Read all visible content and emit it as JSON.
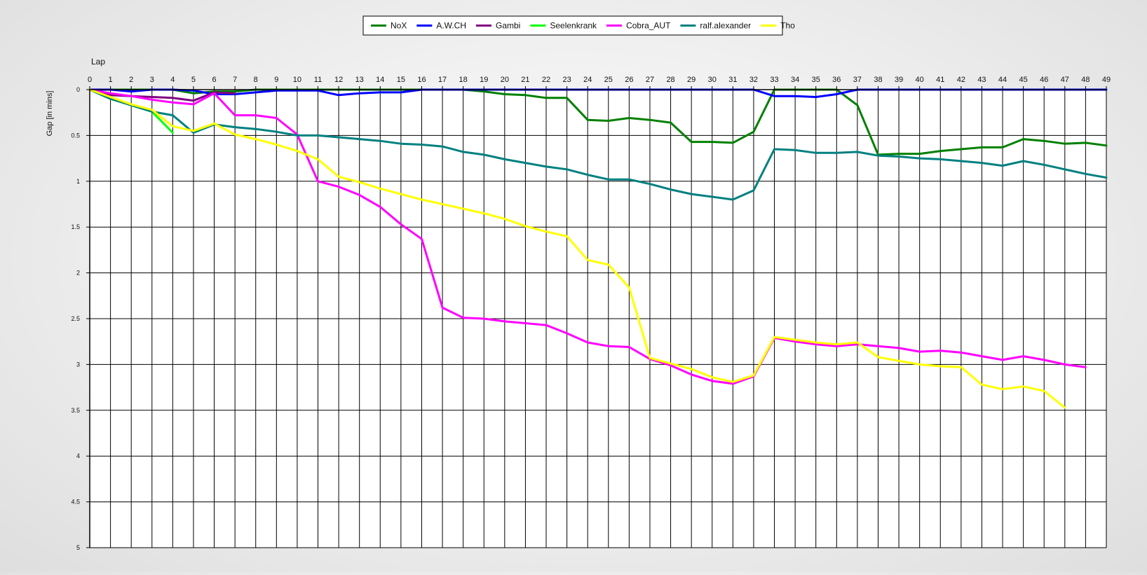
{
  "chart_data": {
    "type": "line",
    "xlabel": "Lap",
    "ylabel": "Gap [in mins]",
    "x": [
      0,
      1,
      2,
      3,
      4,
      5,
      6,
      7,
      8,
      9,
      10,
      11,
      12,
      13,
      14,
      15,
      16,
      17,
      18,
      19,
      20,
      21,
      22,
      23,
      24,
      25,
      26,
      27,
      28,
      29,
      30,
      31,
      32,
      33,
      34,
      35,
      36,
      37,
      38,
      39,
      40,
      41,
      42,
      43,
      44,
      45,
      46,
      47,
      48,
      49
    ],
    "xlim": [
      0,
      49
    ],
    "ylim": [
      0,
      5
    ],
    "y_inverted": true,
    "y_ticks": [
      "0",
      "0.5",
      "1",
      "1.5",
      "2",
      "2.5",
      "3",
      "3.5",
      "4",
      "4.5",
      "5"
    ],
    "grid": true,
    "legend_position": "top-center",
    "series": [
      {
        "name": "NoX",
        "color": "#008000",
        "values": [
          0,
          0,
          0,
          0,
          0,
          0.04,
          0.02,
          0.02,
          0,
          0,
          0,
          0,
          0,
          0,
          0,
          0,
          0,
          0,
          0,
          0.02,
          0.05,
          0.06,
          0.09,
          0.09,
          0.33,
          0.34,
          0.31,
          0.33,
          0.36,
          0.57,
          0.57,
          0.58,
          0.46,
          0,
          0,
          0,
          0,
          0.17,
          0.71,
          0.7,
          0.7,
          0.67,
          0.65,
          0.63,
          0.63,
          0.54,
          0.56,
          0.59,
          0.58,
          0.61
        ]
      },
      {
        "name": "A.W.CH",
        "color": "#0000ff",
        "values": [
          0,
          0,
          0.02,
          0,
          0,
          0.01,
          0.05,
          0.05,
          0.03,
          0.01,
          0.01,
          0.01,
          0.06,
          0.04,
          0.03,
          0.03,
          0,
          0,
          0,
          0,
          0,
          0,
          0,
          0,
          0,
          0,
          0,
          0,
          0,
          0,
          0,
          0,
          0,
          0.07,
          0.07,
          0.08,
          0.05,
          0,
          0,
          0,
          0,
          0,
          0,
          0,
          0,
          0,
          0,
          0,
          0,
          0
        ]
      },
      {
        "name": "Gambi",
        "color": "#800080",
        "values": [
          0,
          0.06,
          0.07,
          0.08,
          0.09,
          0.12,
          0.03,
          0.04,
          null,
          null,
          null,
          null,
          null,
          null,
          null,
          null,
          null,
          null,
          null,
          null,
          null,
          null,
          null,
          null,
          null,
          null,
          null,
          null,
          null,
          null,
          null,
          null,
          null,
          null,
          null,
          null,
          null,
          null,
          null,
          null,
          null,
          null,
          null,
          null,
          null,
          null,
          null,
          null,
          null,
          null
        ]
      },
      {
        "name": "Seelenkrank",
        "color": "#00ff00",
        "values": [
          0,
          0.1,
          0.17,
          0.24,
          0.47,
          null,
          null,
          null,
          null,
          null,
          null,
          null,
          null,
          null,
          null,
          null,
          null,
          null,
          null,
          null,
          null,
          null,
          null,
          null,
          null,
          null,
          null,
          null,
          null,
          null,
          null,
          null,
          null,
          null,
          null,
          null,
          null,
          null,
          null,
          null,
          null,
          null,
          null,
          null,
          null,
          null,
          null,
          null,
          null,
          null
        ]
      },
      {
        "name": "Cobra_AUT",
        "color": "#ff00ff",
        "values": [
          0,
          0.04,
          0.07,
          0.11,
          0.14,
          0.16,
          0.04,
          0.28,
          0.28,
          0.31,
          0.49,
          1.0,
          1.06,
          1.15,
          1.28,
          1.47,
          1.63,
          2.38,
          2.49,
          2.5,
          2.53,
          2.55,
          2.57,
          2.66,
          2.76,
          2.8,
          2.81,
          2.94,
          3.01,
          3.11,
          3.18,
          3.21,
          3.13,
          2.71,
          2.75,
          2.78,
          2.8,
          2.78,
          2.8,
          2.82,
          2.86,
          2.85,
          2.87,
          2.91,
          2.95,
          2.91,
          2.95,
          3.0,
          3.03,
          null
        ]
      },
      {
        "name": "ralf.alexander",
        "color": "#008080",
        "values": [
          0,
          0.1,
          0.17,
          0.24,
          0.28,
          0.47,
          0.38,
          0.41,
          0.43,
          0.46,
          0.5,
          0.5,
          0.52,
          0.54,
          0.56,
          0.59,
          0.6,
          0.62,
          0.68,
          0.71,
          0.76,
          0.8,
          0.84,
          0.87,
          0.93,
          0.98,
          0.98,
          1.03,
          1.09,
          1.14,
          1.17,
          1.2,
          1.1,
          0.65,
          0.66,
          0.69,
          0.69,
          0.68,
          0.72,
          0.73,
          0.75,
          0.76,
          0.78,
          0.8,
          0.83,
          0.78,
          0.82,
          0.87,
          0.92,
          0.96
        ]
      },
      {
        "name": "Tho",
        "color": "#ffff00",
        "values": [
          0,
          0.08,
          0.16,
          0.22,
          0.4,
          0.45,
          0.37,
          0.49,
          0.54,
          0.6,
          0.67,
          0.76,
          0.95,
          1.01,
          1.08,
          1.14,
          1.2,
          1.25,
          1.3,
          1.35,
          1.41,
          1.49,
          1.55,
          1.6,
          1.86,
          1.91,
          2.16,
          2.93,
          2.99,
          3.05,
          3.14,
          3.19,
          3.12,
          2.7,
          2.73,
          2.76,
          2.78,
          2.76,
          2.92,
          2.96,
          3.0,
          3.02,
          3.03,
          3.22,
          3.27,
          3.24,
          3.29,
          3.47,
          null,
          null
        ]
      }
    ]
  }
}
